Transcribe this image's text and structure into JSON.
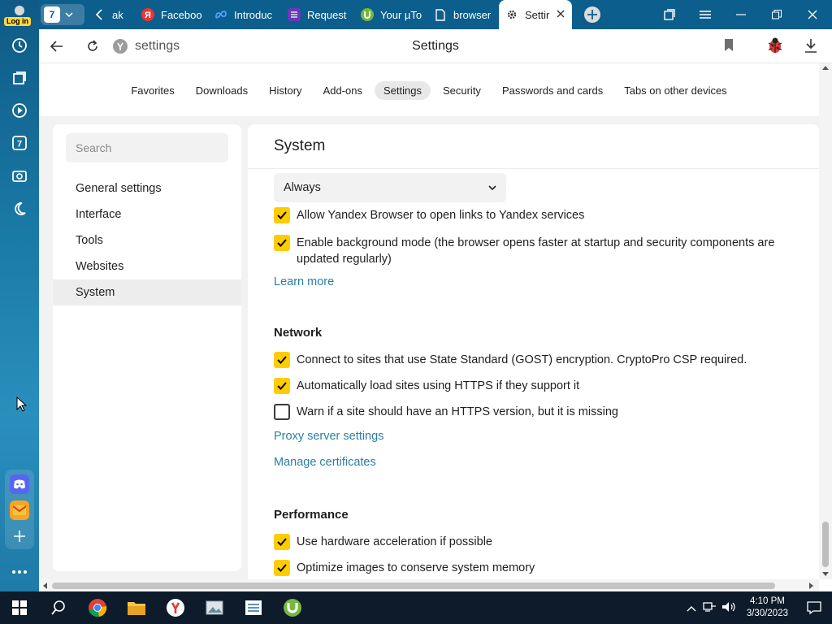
{
  "sidebar": {
    "login_label": "Log in",
    "tab_count": "7",
    "items": [
      "history-icon",
      "collections-icon",
      "play-icon",
      "tab-counter-icon",
      "screenshot-icon",
      "night-mode-icon"
    ],
    "apps": [
      "discord-icon",
      "mail-icon",
      "add-icon"
    ],
    "more": "more-icon"
  },
  "tabs": {
    "counter": "7",
    "items": [
      {
        "title": "ak",
        "icon": "back-arrow-icon"
      },
      {
        "title": "Faceboo",
        "icon": "yandex-icon"
      },
      {
        "title": "Introduc",
        "icon": "meta-icon"
      },
      {
        "title": "Request",
        "icon": "form-icon"
      },
      {
        "title": "Your µTo",
        "icon": "utorrent-icon"
      },
      {
        "title": "browser",
        "icon": "document-icon"
      },
      {
        "title": "Settir",
        "icon": "gear-icon"
      }
    ]
  },
  "address": {
    "url": "settings",
    "page_title": "Settings"
  },
  "topnav": {
    "items": [
      "Favorites",
      "Downloads",
      "History",
      "Add-ons",
      "Settings",
      "Security",
      "Passwords and cards",
      "Tabs on other devices"
    ],
    "active": "Settings"
  },
  "left_panel": {
    "search_placeholder": "Search",
    "items": [
      "General settings",
      "Interface",
      "Tools",
      "Websites",
      "System"
    ],
    "active": "System"
  },
  "main": {
    "title": "System",
    "select_value": "Always",
    "system_options": [
      {
        "label": "Allow Yandex Browser to open links to Yandex services",
        "checked": true
      },
      {
        "label": "Enable background mode (the browser opens faster at startup and security components are updated regularly)",
        "checked": true
      }
    ],
    "learn_more": "Learn more",
    "network": {
      "heading": "Network",
      "options": [
        {
          "label": "Connect to sites that use State Standard (GOST) encryption. CryptoPro CSP required.",
          "checked": true
        },
        {
          "label": "Automatically load sites using HTTPS if they support it",
          "checked": true
        },
        {
          "label": "Warn if a site should have an HTTPS version, but it is missing",
          "checked": false
        }
      ],
      "proxy_link": "Proxy server settings",
      "certs_link": "Manage certificates"
    },
    "performance": {
      "heading": "Performance",
      "options": [
        {
          "label": "Use hardware acceleration if possible",
          "checked": true
        },
        {
          "label": "Optimize images to conserve system memory",
          "checked": true
        }
      ]
    }
  },
  "taskbar": {
    "apps": [
      "windows-start-icon",
      "search-icon",
      "chrome-icon",
      "file-explorer-icon",
      "yandex-browser-icon",
      "photos-icon",
      "notepad-icon",
      "utorrent-icon"
    ],
    "time": "4:10 PM",
    "date": "3/30/2023"
  },
  "colors": {
    "accent_yellow": "#ffcc00",
    "link_blue": "#2c7fa6",
    "tabbar_blue": "#0c5e8c",
    "taskbar": "#0d1b2a"
  }
}
